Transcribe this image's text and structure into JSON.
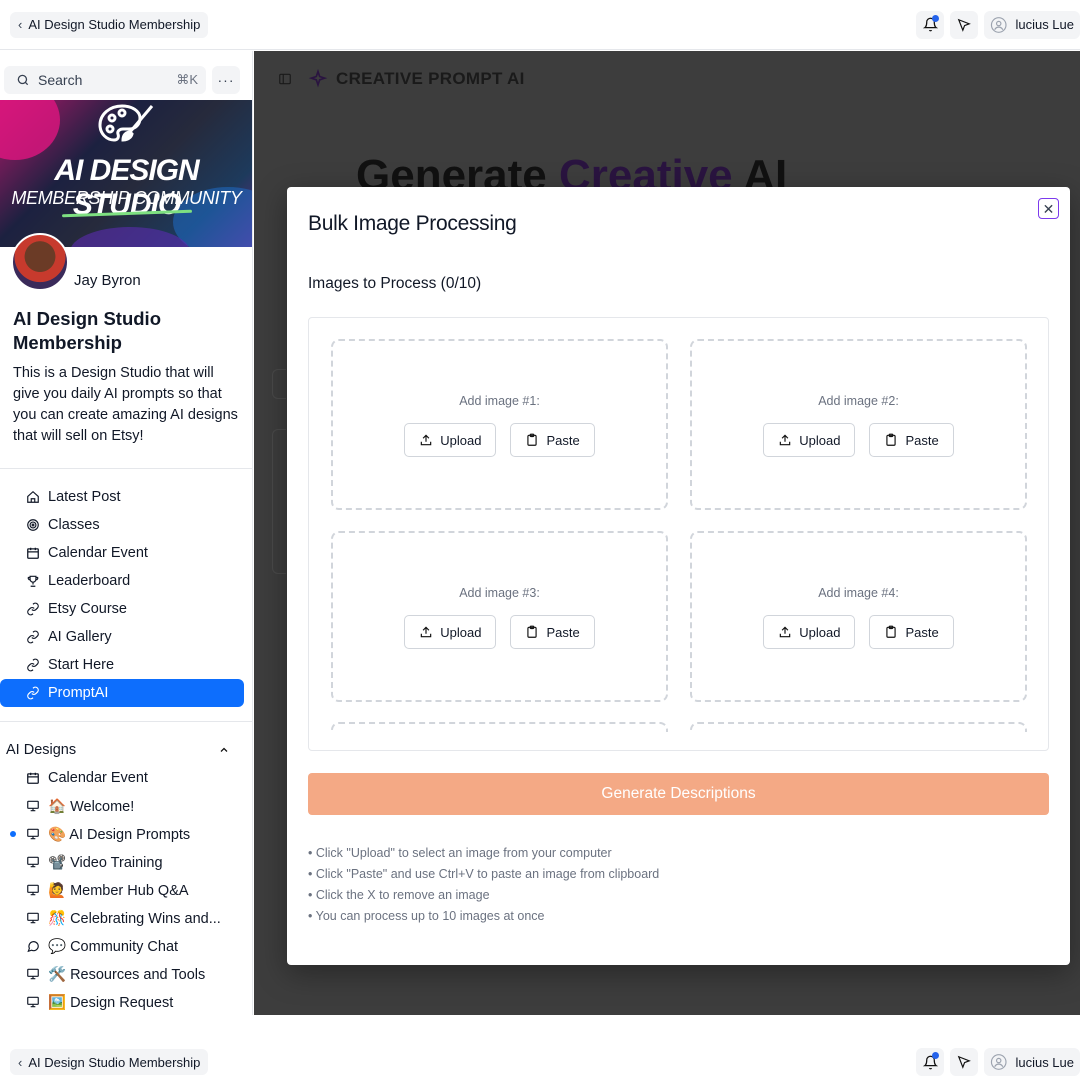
{
  "topbar": {
    "back_label": "AI Design Studio Membership",
    "user_name": "lucius Lue"
  },
  "sidebar": {
    "search_placeholder": "Search",
    "search_shortcut": "⌘K",
    "more_label": "···",
    "banner_title": "AI DESIGN STUDIO",
    "banner_subtitle": "MEMBERSHIP COMMUNITY",
    "creator_name": "Jay Byron",
    "community_title": "AI Design Studio Membership",
    "community_desc": "This is a Design Studio that will give you daily AI prompts so that you can create amazing AI designs that will sell on Etsy!",
    "nav_items": [
      {
        "label": "Latest Post",
        "icon": "home-icon"
      },
      {
        "label": "Classes",
        "icon": "target-icon"
      },
      {
        "label": "Calendar Event",
        "icon": "calendar-icon"
      },
      {
        "label": "Leaderboard",
        "icon": "trophy-icon"
      },
      {
        "label": "Etsy Course",
        "icon": "link-icon"
      },
      {
        "label": "AI Gallery",
        "icon": "link-icon"
      },
      {
        "label": "Start Here",
        "icon": "link-icon"
      },
      {
        "label": "PromptAI",
        "icon": "link-icon",
        "active": true
      }
    ],
    "section_title": "AI Designs",
    "section_items": [
      {
        "label": "Calendar Event",
        "icon": "calendar-icon"
      },
      {
        "label": "🏠 Welcome!",
        "icon": "monitor-icon"
      },
      {
        "label": "🎨 AI Design Prompts",
        "icon": "monitor-icon",
        "unread": true
      },
      {
        "label": "📽️ Video Training",
        "icon": "monitor-icon"
      },
      {
        "label": "🙋 Member Hub Q&A",
        "icon": "monitor-icon"
      },
      {
        "label": "🎊 Celebrating Wins and...",
        "icon": "monitor-icon"
      },
      {
        "label": "💬 Community Chat",
        "icon": "chat-icon"
      },
      {
        "label": "🛠️ Resources and Tools",
        "icon": "monitor-icon"
      },
      {
        "label": "🖼️ Design Request",
        "icon": "monitor-icon"
      }
    ]
  },
  "main": {
    "brand": "CREATIVE PROMPT AI",
    "hero_part1": "Generate ",
    "hero_part2": "Creative",
    "hero_part3": " AI"
  },
  "modal": {
    "title": "Bulk Image Processing",
    "subhead": "Images to Process (0/10)",
    "upload_label": "Upload",
    "paste_label": "Paste",
    "slots": [
      {
        "label": "Add image #1:"
      },
      {
        "label": "Add image #2:"
      },
      {
        "label": "Add image #3:"
      },
      {
        "label": "Add image #4:"
      }
    ],
    "generate_label": "Generate Descriptions",
    "generate_color": "#f4a985",
    "tips": [
      "• Click \"Upload\" to select an image from your computer",
      "• Click \"Paste\" and use Ctrl+V to paste an image from clipboard",
      "• Click the X to remove an image",
      "• You can process up to 10 images at once"
    ]
  },
  "colors": {
    "accent": "#0d6efd",
    "overlay": "#3d3d3d"
  }
}
